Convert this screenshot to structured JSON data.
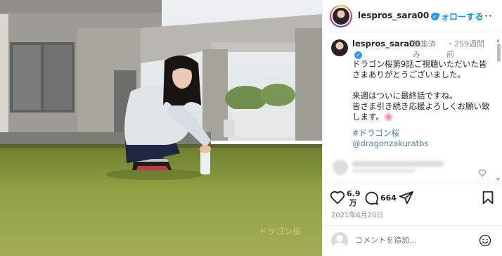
{
  "header": {
    "username": "lespros_sara00",
    "verified_mark": "✓",
    "follow_label": "フォローする",
    "more_label": "···"
  },
  "caption": {
    "username": "lespros_sara00",
    "edited_label": "編集済み",
    "time_label": "・259週間前",
    "text": "ドラゴン桜第9話ご視聴いただいた皆さまありがとうございました。\n\n来週はついに最終話ですね。\n皆さま引き続き応援よろしくお願い致します。",
    "emoji": "🌸",
    "hashtag": "#ドラゴン桜",
    "mention": "@dragonzakuratbs"
  },
  "actions": {
    "like_count": "6.9万",
    "comment_count": "664",
    "date": "2021年6月20日",
    "icons": [
      "heart-icon",
      "comment-icon",
      "share-icon",
      "bookmark-icon"
    ]
  },
  "add_comment": {
    "placeholder": "コメントを追加..."
  },
  "photo": {
    "watermark": "ドラゴン桜",
    "colors": {
      "grass": "#8a9a3c",
      "sky": "#e6ecef",
      "building": "#a9a8a2"
    }
  },
  "colors": {
    "accent": "#0095f6",
    "text": "#262626",
    "muted": "#8e8e8e"
  }
}
